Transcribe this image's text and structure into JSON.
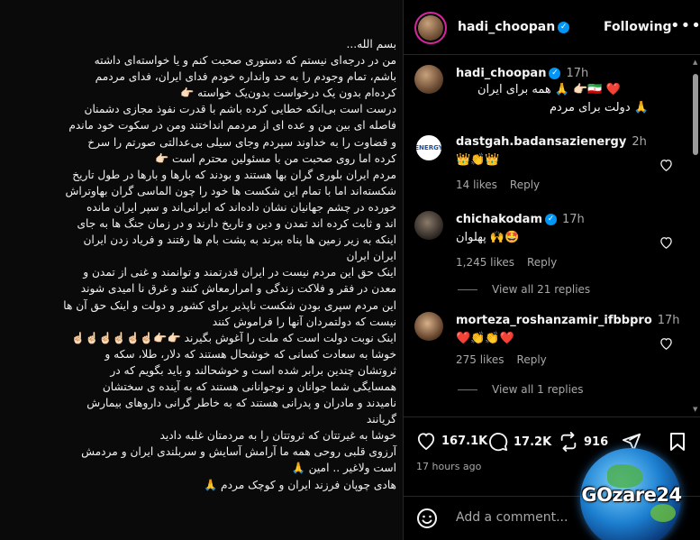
{
  "post": {
    "text": "بسم الله...\nمن در درجه‌ای نیستم که دستوری صحبت کنم و یا خواسته‌ای داشته\nباشم، تمام وجودم  را به حد وانداره خودم فدای ایران، فدای مردمم\nکرده‌ام بدون یک درخواست بدون‌یک خواسته 👉🏻\nدرست است بی‌انکه خطایی کرده باشم با قدرت نفوذ مجازی دشمنان\nفاصله ای بین من و عده ای از مردمم انداختند ومن در سکوت خود ماندم\nو قضاوت را به خداوند سپردم وجای سیلی بی‌عدالتی صورتم را سرخ\nکرده اما روی صحبت من با مسئولین محترم است 👉🏻\nمردم ایران بلوری گران بها هستند و بودند که بارها و بارها در طول تاریخ\nشکسته‌اند اما با تمام این شکست ها خود را چون الماسی گران بهاوتراش\nخورده در چشم جهانیان نشان داده‌اند که ایرانی‌اند و سپر ایران مانده\nاند و ثابت کرده اند تمدن و دین و تاریخ دارند و در زمان جنگ ها به جای\nاینکه به زیر زمین ها پناه  ببرند به پشت بام ها رفتند و فریاد زدن ایران\nایران ایران\nاینک حق این مردم نیست در ایران قدرتمند و توانمند و غنی از تمدن و\nمعدن در فقر و فلاکت زندگی و امرارمعاش کنند و غرق نا امیدی شوند\nاین مردم سپری بودن شکست ناپذیر برای کشور و دولت و اینک حق آن ها\nنیست که دولتمردان آنها را فراموش کنند\nاینک نوبت دولت است که ملت را آغوش بگیرند 👉🏻👉🏻☝🏻☝🏻☝🏻☝🏻☝🏻☝🏻\nخوشا به سعادت کسانی که خوشحال هستند که دلار، طلا، سکه و\nثروتشان چندین برابر شده است و خوشحالند و باید بگویم که در\nهمسایگی شما جوانان و نوجوانانی هستند که به آینده ی سختشان\nنامیدند و مادران و پدرانی هستند که به خاطر گرانی داروهای بیمارش\nگریانند\nخوشا به غیرتتان که ثروتتان را به مردمتان غلبه دادید\nآرزوی قلبی روحی همه ما آرامش آسایش و سربلندی ایران و مردمش\nاست ولاغیر .. امین 🙏\nهادی چوپان  فرزند ایران و کوچک مردم 🙏"
  },
  "header": {
    "username": "hadi_choopan",
    "follow_label": "Following",
    "more_label": "•••"
  },
  "caption": {
    "username": "hadi_choopan",
    "time": "17h",
    "line1": "❤️ 🇮🇷👉🏻 🙏 همه برای ایران",
    "line2": "🙏 دولت برای مردم"
  },
  "comments": [
    {
      "username": "dastgah.badansazienergy",
      "time": "2h",
      "text": "👑👏👑",
      "likes": "14 likes",
      "reply": "Reply",
      "avatar_text": "ENERGY"
    },
    {
      "username": "chichakodam",
      "time": "17h",
      "text": "پهلوان 🙌🤩",
      "likes": "1,245 likes",
      "reply": "Reply",
      "replies": "View all 21 replies"
    },
    {
      "username": "morteza_roshanzamir_ifbbpro",
      "time": "17h",
      "text": "❤️👏👏❤️",
      "likes": "275 likes",
      "reply": "Reply",
      "replies": "View all 1 replies"
    }
  ],
  "actions": {
    "likes_count": "167.1K",
    "comments_count": "17.2K",
    "reposts_count": "916",
    "time_ago": "17 hours ago"
  },
  "add_comment": {
    "placeholder": "Add a comment..."
  },
  "watermark": {
    "text": "GOzare24"
  }
}
